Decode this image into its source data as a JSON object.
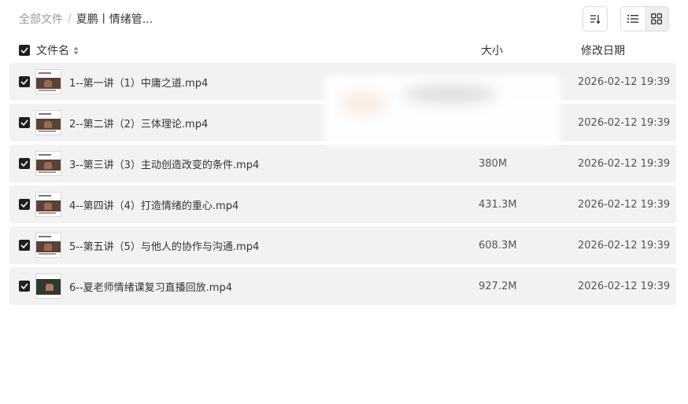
{
  "breadcrumb": {
    "root": "全部文件",
    "separator": "/",
    "current": "夏鹏丨情绪管..."
  },
  "toolbar": {
    "sort_icon": "sort-descending-icon",
    "list_view_icon": "list-view-icon",
    "grid_view_icon": "grid-view-icon",
    "active_view": "list"
  },
  "table": {
    "headers": {
      "name": "文件名",
      "size": "大小",
      "date": "修改日期"
    },
    "rows": [
      {
        "name": "1--第一讲（1）中庸之道.mp4",
        "size": "",
        "date": "2026-02-12 19:39",
        "checked": true
      },
      {
        "name": "2--第二讲（2）三体理论.mp4",
        "size": "",
        "date": "2026-02-12 19:39",
        "checked": true
      },
      {
        "name": "3--第三讲（3）主动创造改变的条件.mp4",
        "size": "380M",
        "date": "2026-02-12 19:39",
        "checked": true
      },
      {
        "name": "4--第四讲（4）打造情绪的重心.mp4",
        "size": "431.3M",
        "date": "2026-02-12 19:39",
        "checked": true
      },
      {
        "name": "5--第五讲（5）与他人的协作与沟通.mp4",
        "size": "608.3M",
        "date": "2026-02-12 19:39",
        "checked": true
      },
      {
        "name": "6--夏老师情绪课复习直播回放.mp4",
        "size": "927.2M",
        "date": "2026-02-12 19:39",
        "checked": true
      }
    ]
  },
  "colors": {
    "row_background": "#f2f2f2",
    "checkbox": "#1f1f1f",
    "muted_text": "#999999"
  }
}
